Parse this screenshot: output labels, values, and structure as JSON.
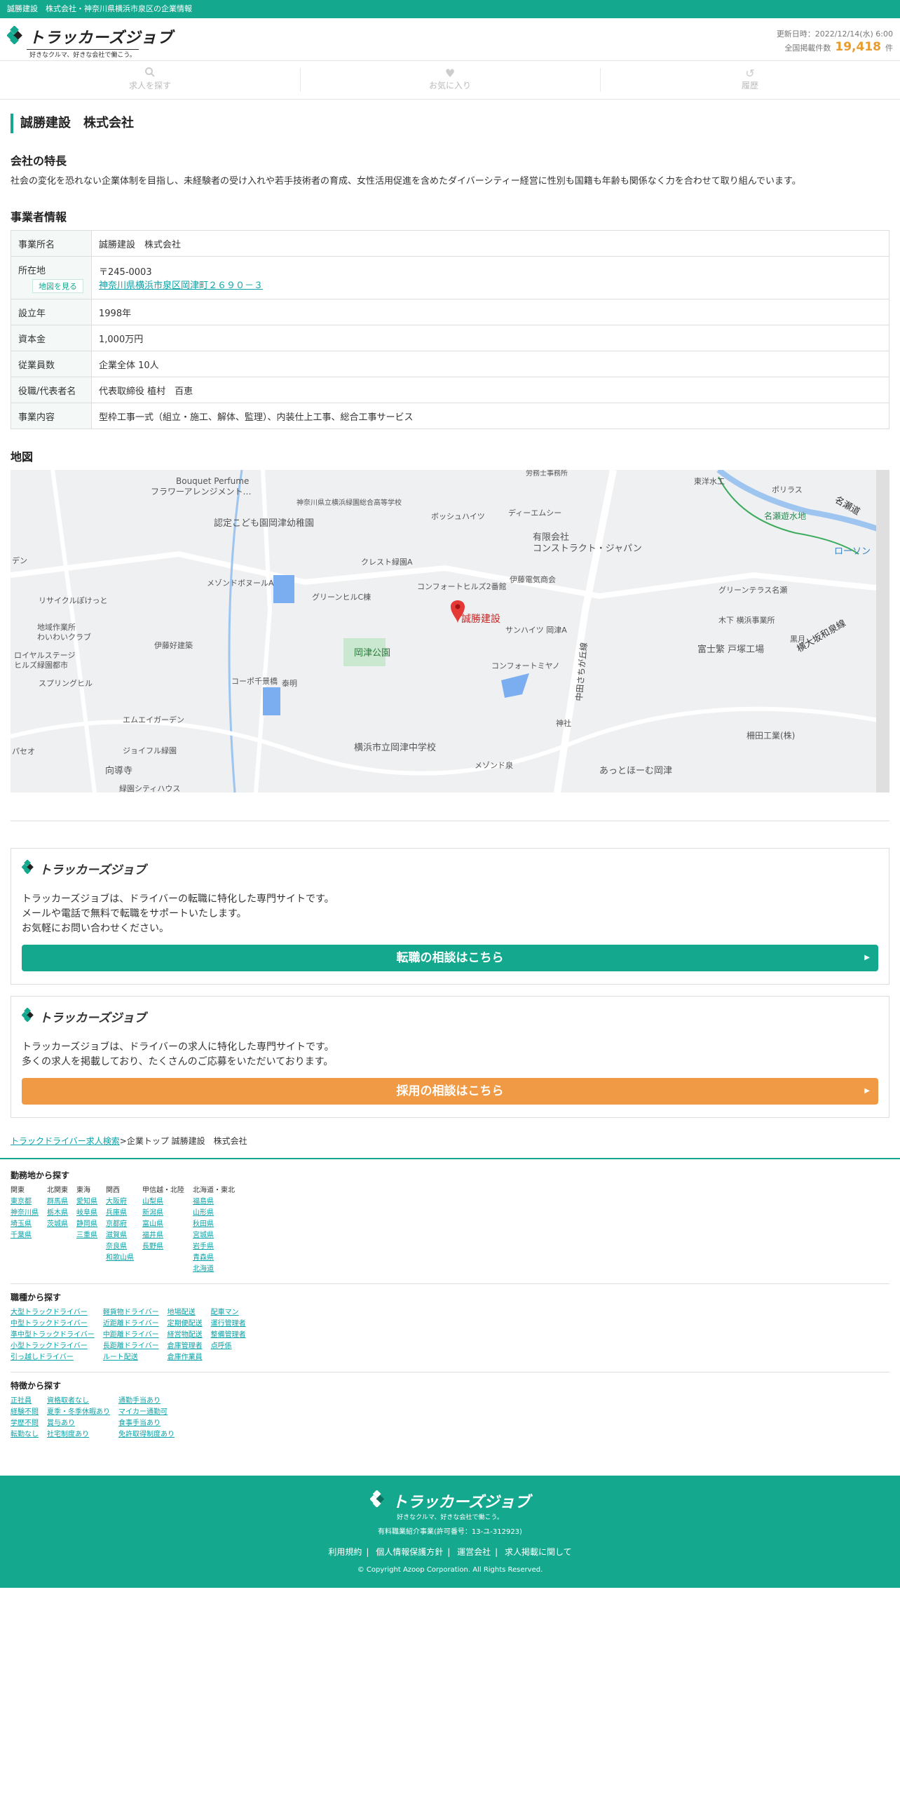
{
  "topbar": {
    "text": "誠勝建設　株式会社・神奈川県横浜市泉区の企業情報"
  },
  "header": {
    "logo_name": "トラッカーズジョブ",
    "logo_tagline": "好きなクルマ、好きな会社で働こう。",
    "updated": "更新日時：2022/12/14(水) 6:00",
    "count_label": "全国掲載件数",
    "count": "19,418",
    "count_unit": "件"
  },
  "nav": [
    {
      "label": "求人を探す",
      "icon": "search-icon"
    },
    {
      "label": "お気に入り",
      "icon": "heart-icon"
    },
    {
      "label": "履歴",
      "icon": "history-icon"
    }
  ],
  "company": {
    "title": "誠勝建設　株式会社",
    "feature_heading": "会社の特長",
    "feature_text": "社会の変化を恐れない企業体制を目指し、未経験者の受け入れや若手技術者の育成、女性活用促進を含めたダイバーシティー経営に性別も国籍も年齢も関係なく力を合わせて取り組んでいます。",
    "info_heading": "事業者情報",
    "rows": [
      {
        "key": "事業所名",
        "value": "誠勝建設　株式会社"
      },
      {
        "key": "所在地",
        "postal": "〒245-0003",
        "address": "神奈川県横浜市泉区岡津町２６９０－３",
        "map_btn": "地図を見る"
      },
      {
        "key": "設立年",
        "value": "1998年"
      },
      {
        "key": "資本金",
        "value": "1,000万円"
      },
      {
        "key": "従業員数",
        "value": "企業全体 10人"
      },
      {
        "key": "役職/代表者名",
        "value": "代表取締役 植村　百恵"
      },
      {
        "key": "事業内容",
        "value": "型枠工事一式（組立・施工、解体、監理）、内装仕上工事、総合工事サービス"
      }
    ],
    "map_heading": "地図"
  },
  "map_labels": {
    "marker": "誠勝建設",
    "places": [
      "Bouquet Perfume",
      "フラワーアレンジメント…",
      "神奈川県立横浜緑園総合高等学校",
      "認定こども園岡津幼稚園",
      "ボッシュハイツ",
      "ディーエムシー",
      "有限会社",
      "コンストラクト・ジャパン",
      "クレスト緑園A",
      "コンフォートヒルズ2番館",
      "伊藤電気商会",
      "グリーンヒルC棟",
      "メゾンドボヌールA",
      "リサイクルぽけっと",
      "地域作業所",
      "わいわいクラブ",
      "伊藤好建築",
      "ロイヤルステージ",
      "ヒルズ緑園都市",
      "スプリングヒル",
      "岡津公園",
      "サンハイツ 岡津A",
      "コンフォートミヤノ",
      "コーポ千景橋",
      "泰明",
      "エムエイガーデン",
      "ジョイフル緑園",
      "向導寺",
      "横浜市立岡津中学校",
      "メゾンド泉",
      "神社",
      "あっとほーむ岡津",
      "中田さちが丘線",
      "富士繁 戸塚工場",
      "木下 横浜事業所",
      "グリーンテラス名瀬",
      "名瀬遊水地",
      "東洋水工",
      "ポリラス",
      "名瀬道",
      "黒月",
      "横大坂和泉線",
      "ローソン",
      "柵田工業(株)",
      "労務士事務所",
      "緑園シティハウス",
      "デン",
      "パセオ"
    ]
  },
  "promos": [
    {
      "text": [
        "トラッカーズジョブは、ドライバーの転職に特化した専門サイトです。",
        "メールや電話で無料で転職をサポートいたします。",
        "お気軽にお問い合わせください。"
      ],
      "button": "転職の相談はこちら",
      "color": "#14a98f"
    },
    {
      "text": [
        "トラッカーズジョブは、ドライバーの求人に特化した専門サイトです。",
        "多くの求人を掲載しており、たくさんのご応募をいただいております。"
      ],
      "button": "採用の相談はこちら",
      "color": "#f09a45"
    }
  ],
  "breadcrumb": {
    "link": "トラックドライバー求人検索",
    "rest": ">企業トップ 誠勝建設　株式会社"
  },
  "search_by_area": {
    "heading": "勤務地から探す",
    "columns": [
      {
        "head": "関東",
        "items": [
          "東京都",
          "神奈川県",
          "埼玉県",
          "千葉県"
        ]
      },
      {
        "head": "北関東",
        "items": [
          "群馬県",
          "栃木県",
          "茨城県"
        ]
      },
      {
        "head": "東海",
        "items": [
          "愛知県",
          "岐阜県",
          "静岡県",
          "三重県"
        ]
      },
      {
        "head": "関西",
        "items": [
          "大阪府",
          "兵庫県",
          "京都府",
          "滋賀県",
          "奈良県",
          "和歌山県"
        ]
      },
      {
        "head": "甲信越・北陸",
        "items": [
          "山梨県",
          "新潟県",
          "富山県",
          "福井県",
          "長野県"
        ]
      },
      {
        "head": "北海道・東北",
        "items": [
          "福島県",
          "山形県",
          "秋田県",
          "宮城県",
          "岩手県",
          "青森県",
          "北海道"
        ]
      }
    ]
  },
  "search_by_job": {
    "heading": "職種から探す",
    "columns": [
      {
        "items": [
          "大型トラックドライバー",
          "中型トラックドライバー",
          "準中型トラックドライバー",
          "小型トラックドライバー",
          "引っ越しドライバー"
        ]
      },
      {
        "items": [
          "軽貨物ドライバー",
          "近距離ドライバー",
          "中距離ドライバー",
          "長距離ドライバー",
          "ルート配送"
        ]
      },
      {
        "items": [
          "地場配送",
          "定期便配送",
          "経営物配送",
          "倉庫管理者",
          "倉庫作業員"
        ]
      },
      {
        "items": [
          "配車マン",
          "運行管理者",
          "整備管理者",
          "点呼係"
        ]
      }
    ]
  },
  "search_by_feature": {
    "heading": "特徴から探す",
    "columns": [
      {
        "items": [
          "正社員",
          "経験不問",
          "学歴不問",
          "転勤なし"
        ]
      },
      {
        "items": [
          "資格取者なし",
          "夏季・冬季休暇あり",
          "賞与あり",
          "社宅制度あり"
        ]
      },
      {
        "items": [
          "通勤手当あり",
          "マイカー通勤可",
          "食事手当あり",
          "免許取得制度あり"
        ]
      }
    ]
  },
  "footer": {
    "logo_name": "トラッカーズジョブ",
    "tagline": "好きなクルマ、好きな会社で働こう。",
    "license": "有料職業紹介事業(許可番号：13-ユ-312923)",
    "links": [
      "利用規約",
      "個人情報保護方針",
      "運営会社",
      "求人掲載に関して"
    ],
    "copyright": "© Copyright Azoop Corporation. All Rights Reserved."
  }
}
